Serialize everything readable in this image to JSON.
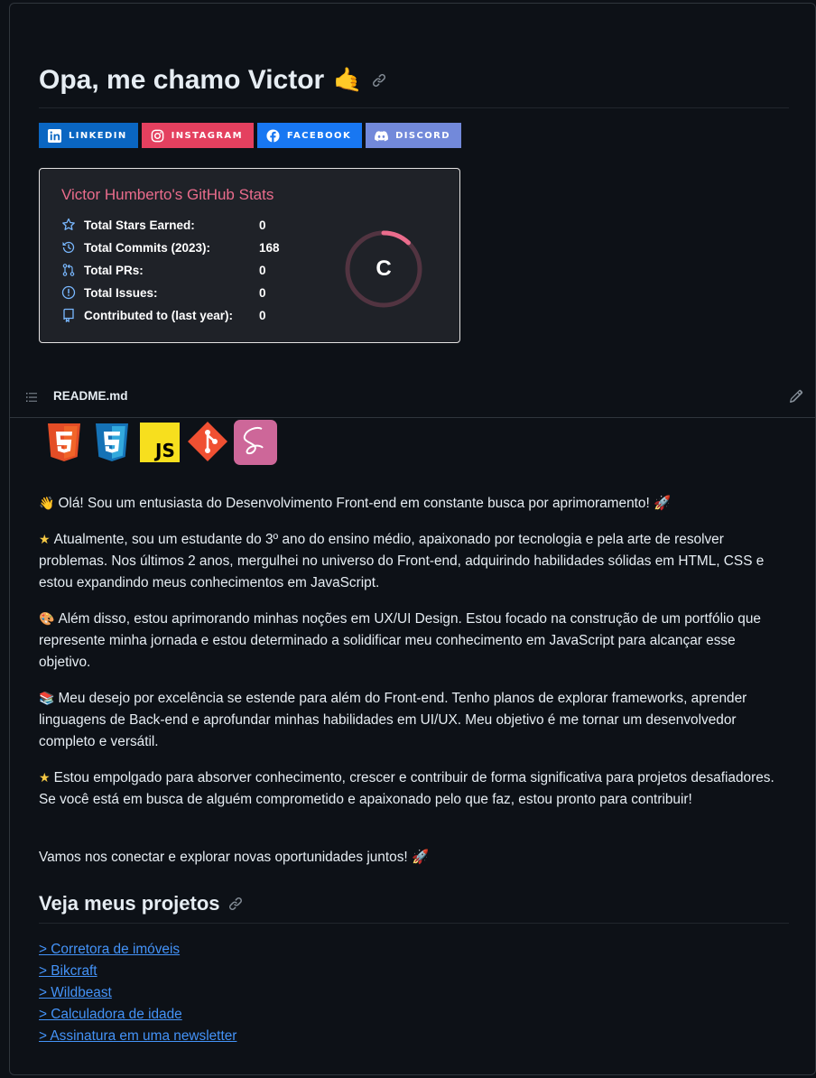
{
  "header": {
    "title": "Opa, me chamo Victor",
    "title_emoji": "🤙"
  },
  "badges": [
    {
      "label": "LINKEDIN",
      "color": "#0a66c2",
      "icon": "linkedin-icon"
    },
    {
      "label": "INSTAGRAM",
      "color": "#e4405f",
      "icon": "instagram-icon"
    },
    {
      "label": "FACEBOOK",
      "color": "#1877f2",
      "icon": "facebook-icon"
    },
    {
      "label": "DISCORD",
      "color": "#7289da",
      "icon": "discord-icon"
    }
  ],
  "stats": {
    "title": "Victor Humberto's GitHub Stats",
    "rows": [
      {
        "label": "Total Stars Earned:",
        "value": "0",
        "icon": "star-icon"
      },
      {
        "label": "Total Commits (2023):",
        "value": "168",
        "icon": "history-icon"
      },
      {
        "label": "Total PRs:",
        "value": "0",
        "icon": "pull-request-icon"
      },
      {
        "label": "Total Issues:",
        "value": "0",
        "icon": "issue-icon"
      },
      {
        "label": "Contributed to (last year):",
        "value": "0",
        "icon": "repo-icon"
      }
    ],
    "rank": "C",
    "rank_progress": 0.12
  },
  "readme": {
    "filename": "README.md"
  },
  "techs": [
    "html5-icon",
    "css3-icon",
    "javascript-icon",
    "git-icon",
    "sass-icon"
  ],
  "paragraphs": [
    {
      "emoji": "👋",
      "text": "Olá! Sou um entusiasta do Desenvolvimento Front-end em constante busca por aprimoramento! 🚀"
    },
    {
      "emoji": "★",
      "text": "Atualmente, sou um estudante do 3º ano do ensino médio, apaixonado por tecnologia e pela arte de resolver problemas. Nos últimos 2 anos, mergulhei no universo do Front-end, adquirindo habilidades sólidas em HTML, CSS e estou expandindo meus conhecimentos em JavaScript."
    },
    {
      "emoji": "🎨",
      "text": "Além disso, estou aprimorando minhas noções em UX/UI Design. Estou focado na construção de um portfólio que represente minha jornada e estou determinado a solidificar meu conhecimento em JavaScript para alcançar esse objetivo."
    },
    {
      "emoji": "📚",
      "text": "Meu desejo por excelência se estende para além do Front-end. Tenho planos de explorar frameworks, aprender linguagens de Back-end e aprofundar minhas habilidades em UI/UX. Meu objetivo é me tornar um desenvolvedor completo e versátil."
    },
    {
      "emoji": "★",
      "text": "Estou empolgado para absorver conhecimento, crescer e contribuir de forma significativa para projetos desafiadores. Se você está em busca de alguém comprometido e apaixonado pelo que faz, estou pronto para contribuir!"
    },
    {
      "emoji": "",
      "text": "Vamos nos conectar e explorar novas oportunidades juntos! 🚀"
    }
  ],
  "projects": {
    "heading": "Veja meus projetos",
    "links": [
      "> Corretora de imóveis",
      "> Bikcraft",
      "> Wildbeast",
      "> Calculadora de idade",
      "> Assinatura em uma newsletter"
    ]
  }
}
